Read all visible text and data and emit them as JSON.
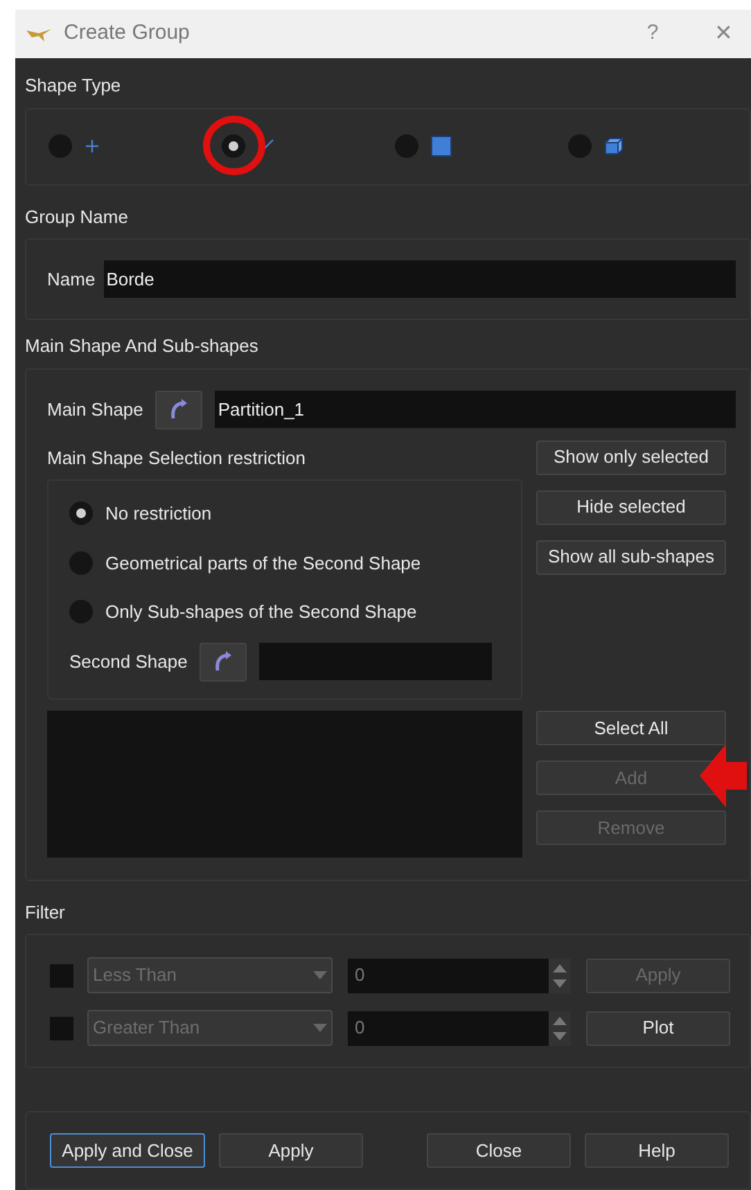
{
  "window": {
    "title": "Create Group",
    "help": "?",
    "close": "✕"
  },
  "shape_type": {
    "label": "Shape Type",
    "options": [
      {
        "kind": "vertex",
        "selected": false,
        "highlighted": false
      },
      {
        "kind": "edge",
        "selected": true,
        "highlighted": true
      },
      {
        "kind": "face",
        "selected": false,
        "highlighted": false
      },
      {
        "kind": "solid",
        "selected": false,
        "highlighted": false
      }
    ]
  },
  "group_name": {
    "label": "Group Name",
    "field_label": "Name",
    "value": "Borde"
  },
  "main_shape": {
    "label": "Main Shape And Sub-shapes",
    "field_label": "Main Shape",
    "value": "Partition_1",
    "restriction_label": "Main Shape Selection restriction",
    "restrictions": [
      {
        "label": "No restriction",
        "selected": true
      },
      {
        "label": "Geometrical parts of the Second Shape",
        "selected": false
      },
      {
        "label": "Only Sub-shapes of the Second Shape",
        "selected": false
      }
    ],
    "second_shape_label": "Second Shape",
    "view_buttons": [
      {
        "label": "Show only selected",
        "disabled": false
      },
      {
        "label": "Hide selected",
        "disabled": false
      },
      {
        "label": "Show all sub-shapes",
        "disabled": false
      }
    ],
    "list_buttons": [
      {
        "label": "Select All",
        "disabled": false,
        "pointed": false
      },
      {
        "label": "Add",
        "disabled": true,
        "pointed": true
      },
      {
        "label": "Remove",
        "disabled": true,
        "pointed": false
      }
    ]
  },
  "filter": {
    "label": "Filter",
    "rows": [
      {
        "checked": false,
        "operator": "Less Than",
        "value": "0",
        "button": {
          "label": "Apply",
          "disabled": true
        }
      },
      {
        "checked": false,
        "operator": "Greater Than",
        "value": "0",
        "button": {
          "label": "Plot",
          "disabled": false
        }
      }
    ]
  },
  "footer_buttons": [
    {
      "label": "Apply and Close",
      "focused": true
    },
    {
      "label": "Apply",
      "focused": false
    },
    {
      "label": "Close",
      "focused": false
    },
    {
      "label": "Help",
      "focused": false
    }
  ]
}
